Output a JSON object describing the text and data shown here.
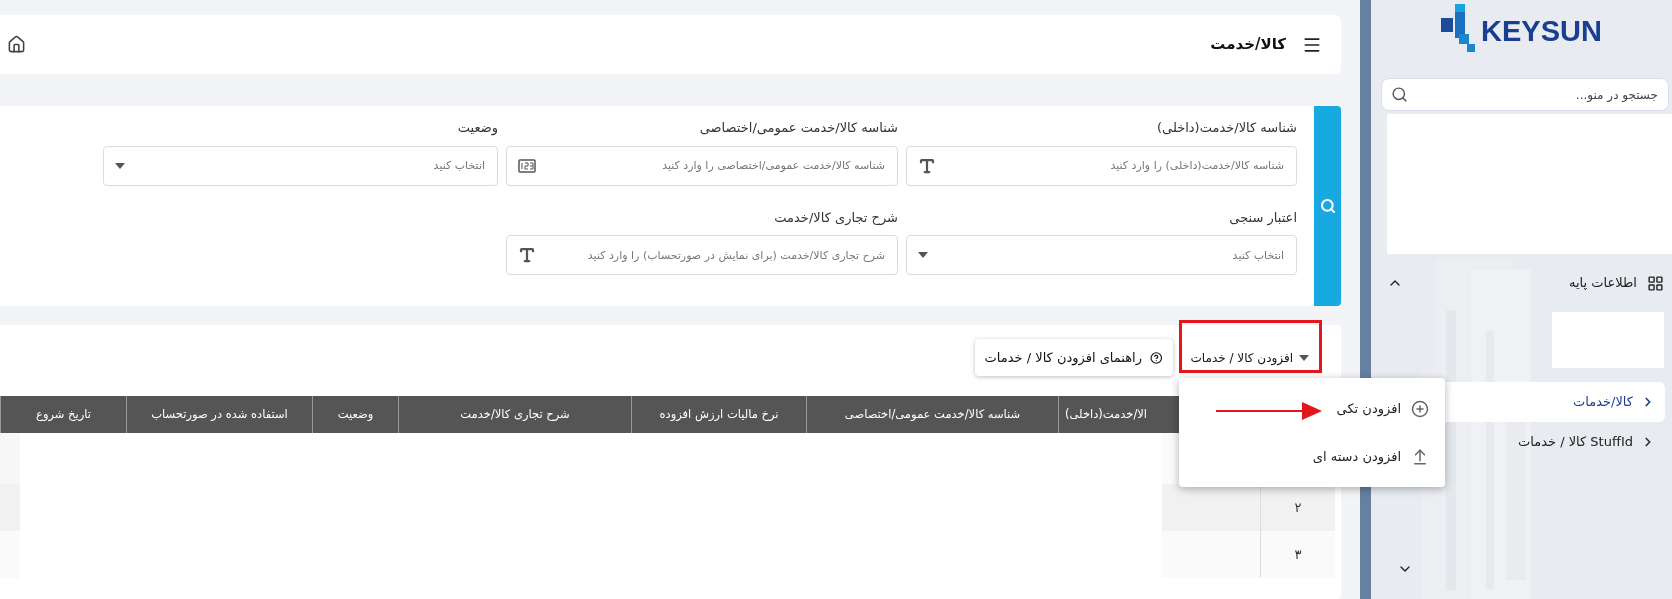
{
  "header": {
    "title": "کالا/خدمت"
  },
  "filters": [
    {
      "label": "شناسه کالا/خدمت(داخلی)",
      "placeholder": "شناسه کالا/خدمت(داخلی) را وارد کنید",
      "kind": "text"
    },
    {
      "label": "شناسه کالا/خدمت عمومی/اختصاصی",
      "placeholder": "شناسه کالا/خدمت عمومی/اختصاصی را وارد کنید",
      "kind": "number"
    },
    {
      "label": "وضعیت",
      "placeholder": "انتخاب کنید",
      "kind": "select"
    },
    {
      "label": "اعتبار سنجی",
      "placeholder": "انتخاب کنید",
      "kind": "select"
    },
    {
      "label": "شرح تجاری کالا/خدمت",
      "placeholder": "شرح تجاری کالا/خدمت (برای نمایش در صورتحساب) را وارد کنید",
      "kind": "text"
    }
  ],
  "toolbar": {
    "add_button": "افزودن کالا / خدمات",
    "help_button": "راهنمای افزودن کالا / خدمات"
  },
  "add_menu": [
    {
      "label": "افزودن تکی",
      "kind": "single"
    },
    {
      "label": "افزودن دسته ای",
      "kind": "bulk"
    }
  ],
  "table": {
    "columns": [
      "الا/خدمت(داخلی)",
      "شناسه کالا/خدمت عمومی/اختصاصی",
      "نرخ مالیات ارزش افزوده",
      "شرح تجاری کالا/خدمت",
      "وضعیت",
      "استفاده شده در صورتحساب",
      "تاریخ شروع"
    ],
    "rows": [
      {
        "number": "۲"
      },
      {
        "number": "۳"
      }
    ]
  },
  "sidebar": {
    "logo": "KEYSUN",
    "search_placeholder": "جستجو در منو...",
    "section": {
      "label": "اطلاعات پایه",
      "expanded": true,
      "items": [
        {
          "label": "کالا/خدمات",
          "selected": true
        },
        {
          "label": "StuffId کالا / خدمات",
          "selected": false
        }
      ]
    }
  }
}
